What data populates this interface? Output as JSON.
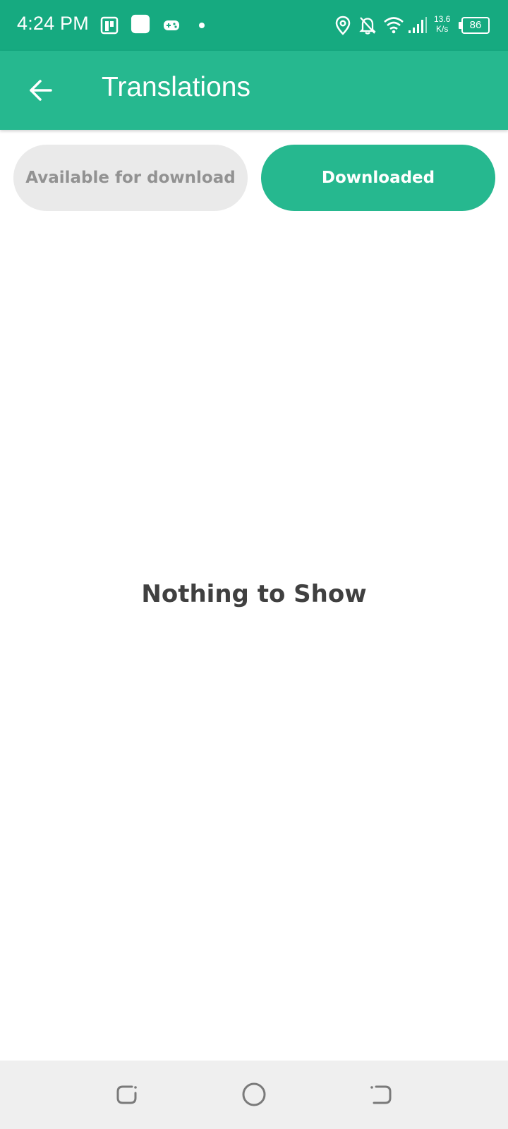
{
  "status_bar": {
    "time": "4:24 PM",
    "speed_value": "13.6",
    "speed_unit": "K/s",
    "battery": "86",
    "icons": [
      "app-icon",
      "blank-app-icon",
      "gamepad-icon",
      "dot-icon",
      "location-icon",
      "bell-off-icon",
      "wifi-icon",
      "signal-icon",
      "battery-icon"
    ]
  },
  "app_bar": {
    "title": "Translations",
    "back_icon": "arrow-left-icon"
  },
  "tabs": [
    {
      "label": "Available for download",
      "selected": false
    },
    {
      "label": "Downloaded",
      "selected": true
    }
  ],
  "empty_state": {
    "message": "Nothing to Show"
  },
  "nav_bar": {
    "buttons": [
      "recent-apps-icon",
      "home-icon",
      "back-icon"
    ]
  },
  "colors": {
    "status_bar": "#16aa80",
    "primary": "#26b88f",
    "tab_inactive_bg": "#eaeaea",
    "tab_inactive_text": "#929292",
    "empty_text": "#404040",
    "nav_bar": "#efefef"
  }
}
